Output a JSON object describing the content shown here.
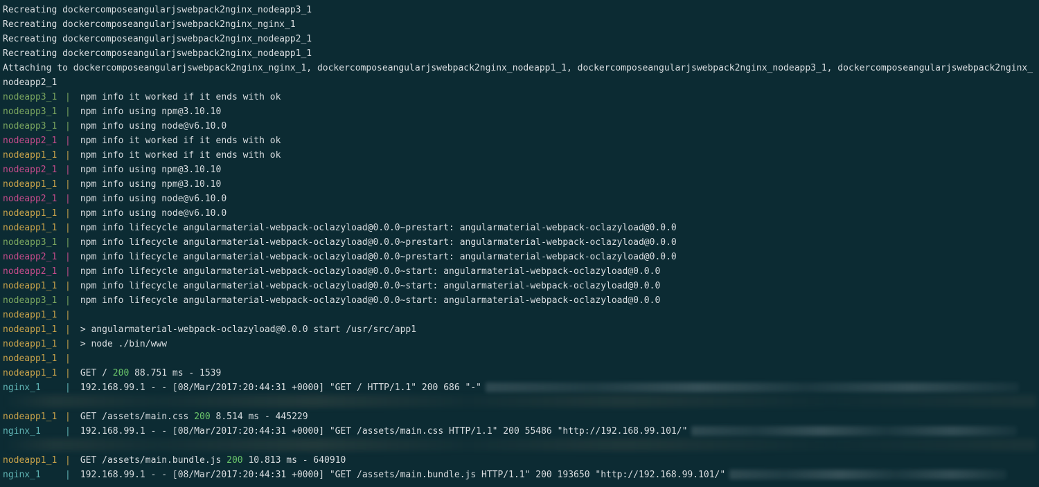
{
  "colors": {
    "nodeapp3": "c-green",
    "nodeapp2": "c-magenta",
    "nodeapp1": "c-yellow",
    "nginx": "c-cyan"
  },
  "header": [
    "Recreating dockercomposeangularjswebpack2nginx_nodeapp3_1",
    "Recreating dockercomposeangularjswebpack2nginx_nginx_1",
    "Recreating dockercomposeangularjswebpack2nginx_nodeapp2_1",
    "Recreating dockercomposeangularjswebpack2nginx_nodeapp1_1",
    "Attaching to dockercomposeangularjswebpack2nginx_nginx_1, dockercomposeangularjswebpack2nginx_nodeapp1_1, dockercomposeangularjswebpack2nginx_nodeapp3_1, dockercomposeangularjswebpack2nginx_",
    "nodeapp2_1"
  ],
  "lines": [
    {
      "src": "nodeapp3_1",
      "color": "nodeapp3",
      "type": "plain",
      "text": "npm info it worked if it ends with ok"
    },
    {
      "src": "nodeapp3_1",
      "color": "nodeapp3",
      "type": "plain",
      "text": "npm info using npm@3.10.10"
    },
    {
      "src": "nodeapp3_1",
      "color": "nodeapp3",
      "type": "plain",
      "text": "npm info using node@v6.10.0"
    },
    {
      "src": "nodeapp2_1",
      "color": "nodeapp2",
      "type": "plain",
      "text": "npm info it worked if it ends with ok"
    },
    {
      "src": "nodeapp1_1",
      "color": "nodeapp1",
      "type": "plain",
      "text": "npm info it worked if it ends with ok"
    },
    {
      "src": "nodeapp2_1",
      "color": "nodeapp2",
      "type": "plain",
      "text": "npm info using npm@3.10.10"
    },
    {
      "src": "nodeapp1_1",
      "color": "nodeapp1",
      "type": "plain",
      "text": "npm info using npm@3.10.10"
    },
    {
      "src": "nodeapp2_1",
      "color": "nodeapp2",
      "type": "plain",
      "text": "npm info using node@v6.10.0"
    },
    {
      "src": "nodeapp1_1",
      "color": "nodeapp1",
      "type": "plain",
      "text": "npm info using node@v6.10.0"
    },
    {
      "src": "nodeapp1_1",
      "color": "nodeapp1",
      "type": "plain",
      "text": "npm info lifecycle angularmaterial-webpack-oclazyload@0.0.0~prestart: angularmaterial-webpack-oclazyload@0.0.0"
    },
    {
      "src": "nodeapp3_1",
      "color": "nodeapp3",
      "type": "plain",
      "text": "npm info lifecycle angularmaterial-webpack-oclazyload@0.0.0~prestart: angularmaterial-webpack-oclazyload@0.0.0"
    },
    {
      "src": "nodeapp2_1",
      "color": "nodeapp2",
      "type": "plain",
      "text": "npm info lifecycle angularmaterial-webpack-oclazyload@0.0.0~prestart: angularmaterial-webpack-oclazyload@0.0.0"
    },
    {
      "src": "nodeapp2_1",
      "color": "nodeapp2",
      "type": "plain",
      "text": "npm info lifecycle angularmaterial-webpack-oclazyload@0.0.0~start: angularmaterial-webpack-oclazyload@0.0.0"
    },
    {
      "src": "nodeapp1_1",
      "color": "nodeapp1",
      "type": "plain",
      "text": "npm info lifecycle angularmaterial-webpack-oclazyload@0.0.0~start: angularmaterial-webpack-oclazyload@0.0.0"
    },
    {
      "src": "nodeapp3_1",
      "color": "nodeapp3",
      "type": "plain",
      "text": "npm info lifecycle angularmaterial-webpack-oclazyload@0.0.0~start: angularmaterial-webpack-oclazyload@0.0.0"
    },
    {
      "src": "nodeapp1_1",
      "color": "nodeapp1",
      "type": "plain",
      "text": ""
    },
    {
      "src": "nodeapp1_1",
      "color": "nodeapp1",
      "type": "plain",
      "text": "> angularmaterial-webpack-oclazyload@0.0.0 start /usr/src/app1"
    },
    {
      "src": "nodeapp1_1",
      "color": "nodeapp1",
      "type": "plain",
      "text": "> node ./bin/www"
    },
    {
      "src": "nodeapp1_1",
      "color": "nodeapp1",
      "type": "plain",
      "text": ""
    },
    {
      "src": "nodeapp1_1",
      "color": "nodeapp1",
      "type": "http",
      "pre": "GET / ",
      "status": "200",
      "post": " 88.751 ms - 1539"
    },
    {
      "src": "nginx_1",
      "color": "nginx",
      "type": "nginx",
      "text": "192.168.99.1 - - [08/Mar/2017:20:44:31 +0000] \"GET / HTTP/1.1\" 200 686 \"-\"",
      "blur_w": 770
    },
    {
      "type": "smear"
    },
    {
      "src": "nodeapp1_1",
      "color": "nodeapp1",
      "type": "http",
      "pre": "GET /assets/main.css ",
      "status": "200",
      "post": " 8.514 ms - 445229"
    },
    {
      "src": "nginx_1",
      "color": "nginx",
      "type": "nginx",
      "text": "192.168.99.1 - - [08/Mar/2017:20:44:31 +0000] \"GET /assets/main.css HTTP/1.1\" 200 55486 \"http://192.168.99.101/\"",
      "blur_w": 470
    },
    {
      "type": "smear"
    },
    {
      "src": "nodeapp1_1",
      "color": "nodeapp1",
      "type": "http",
      "pre": "GET /assets/main.bundle.js ",
      "status": "200",
      "post": " 10.813 ms - 640910"
    },
    {
      "src": "nginx_1",
      "color": "nginx",
      "type": "nginx",
      "text": "192.168.99.1 - - [08/Mar/2017:20:44:31 +0000] \"GET /assets/main.bundle.js HTTP/1.1\" 200 193650 \"http://192.168.99.101/\"",
      "blur_w": 400
    }
  ]
}
